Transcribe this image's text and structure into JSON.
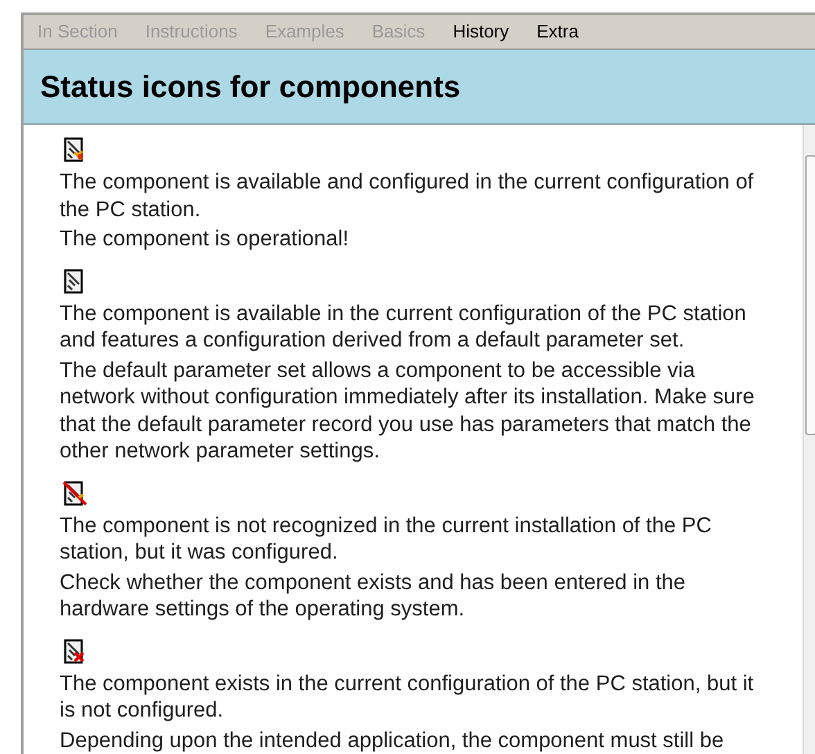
{
  "tabs": [
    {
      "label": "In Section",
      "disabled": true
    },
    {
      "label": "Instructions",
      "disabled": true
    },
    {
      "label": "Examples",
      "disabled": true
    },
    {
      "label": "Basics",
      "disabled": true
    },
    {
      "label": "History",
      "disabled": false
    },
    {
      "label": "Extra",
      "disabled": false
    }
  ],
  "heading": "Status icons for components",
  "entries": [
    {
      "kind": "ok",
      "paragraphs": [
        "The component is available and configured in the current configuration of the PC station.",
        "The component is operational!"
      ]
    },
    {
      "kind": "default",
      "paragraphs": [
        "The component is available in the current configuration of the PC station and features a configuration derived from a default parameter set.",
        "The default parameter set allows a component to be accessible via network without configuration immediately after its installation. Make sure that the default parameter record you use has parameters that match the other network parameter settings."
      ]
    },
    {
      "kind": "not_recognized",
      "paragraphs": [
        "The component is not recognized in the current installation of the PC station, but it was configured.",
        "Check whether the component exists and has been entered in the hardware settings of the operating system."
      ]
    },
    {
      "kind": "not_configured",
      "paragraphs": [
        "The component exists in the current configuration of the PC station, but it is not configured.",
        "Depending upon the intended application, the component must still be"
      ]
    }
  ]
}
